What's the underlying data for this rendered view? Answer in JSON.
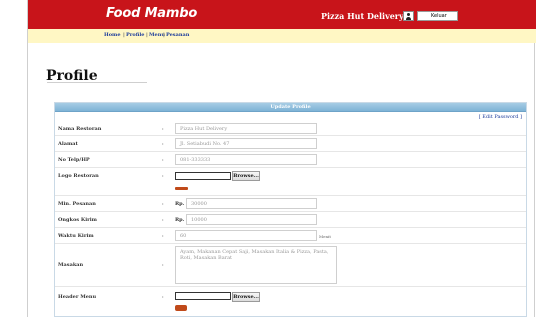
{
  "header": {
    "brand": "Food Mambo",
    "user_name": "Pizza Hut Delivery",
    "logout_label": "Keluar",
    "colors": {
      "topbar": "#c8141a",
      "navbar": "#fff7c4"
    }
  },
  "nav": {
    "items": [
      "Home",
      "Profile",
      "Menu",
      "Pesanan"
    ],
    "separator": "|"
  },
  "page": {
    "title": "Profile"
  },
  "panel": {
    "title": "Update Profile",
    "edit_password": "[ Edit Password ]"
  },
  "form": {
    "colon": ":",
    "nama_restoran": {
      "label": "Nama Restoran",
      "value": "Pizza Hut Delivery"
    },
    "alamat": {
      "label": "Alamat",
      "value": "Jl. Setiabudi No. 47"
    },
    "no_telp": {
      "label": "No Telp/HP",
      "value": "081-333333"
    },
    "logo": {
      "label": "Logo Restoran",
      "button": "Browse..."
    },
    "min_pesanan": {
      "label": "Min. Pesanan",
      "prefix": "Rp.",
      "value": "30000"
    },
    "ongkos_kirim": {
      "label": "Ongkos Kirim",
      "prefix": "Rp.",
      "value": "10000"
    },
    "waktu_kirim": {
      "label": "Waktu Kirim",
      "value": "60",
      "unit": "Menit"
    },
    "masakan": {
      "label": "Masakan",
      "value": "Ayam, Makanan Cepat Saji, Masakan Italia & Pizza, Pasta, Roti, Masakan Barat"
    },
    "header_menu": {
      "label": "Header Menu",
      "button": "Browse..."
    }
  }
}
